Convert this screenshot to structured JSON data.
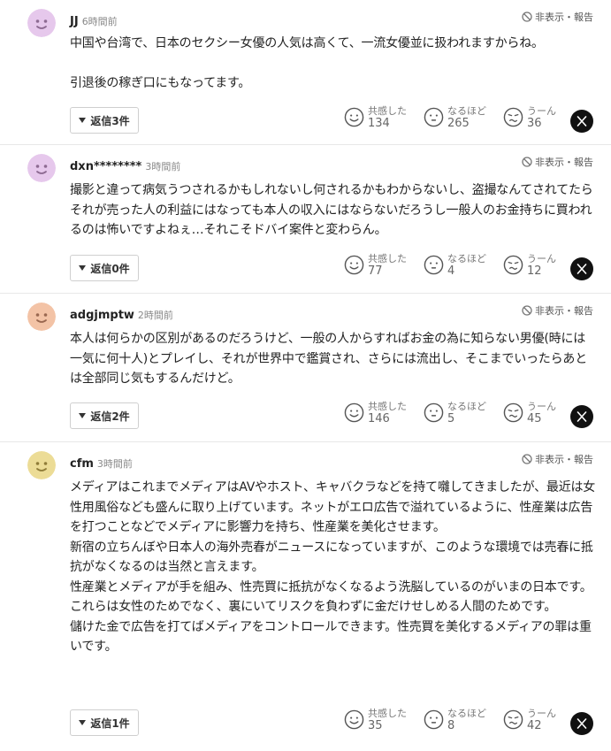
{
  "report_label": "非表示・報告",
  "reactions": {
    "empathy_label": "共感した",
    "naruhodo_label": "なるほど",
    "uun_label": "うーん"
  },
  "comments": [
    {
      "username": "JJ",
      "time": "6時間前",
      "avatar_color": "#e6c8ec",
      "body": "中国や台湾で、日本のセクシー女優の人気は高くて、一流女優並に扱われますからね。\n\n引退後の稼ぎ口にもなってます。",
      "reply_label": "返信3件",
      "empathy": "134",
      "naruhodo": "265",
      "uun": "36"
    },
    {
      "username": "dxn********",
      "time": "3時間前",
      "avatar_color": "#e6c8ec",
      "body": "撮影と違って病気うつされるかもしれないし何されるかもわからないし、盗撮なんてされてたらそれが売った人の利益にはなっても本人の収入にはならないだろうし一般人のお金持ちに買われるのは怖いですよねぇ…それこそドバイ案件と変わらん。",
      "reply_label": "返信0件",
      "empathy": "77",
      "naruhodo": "4",
      "uun": "12"
    },
    {
      "username": "adgjmptw",
      "time": "2時間前",
      "avatar_color": "#f3c3a6",
      "body": "本人は何らかの区別があるのだろうけど、一般の人からすればお金の為に知らない男優(時には一気に何十人)とプレイし、それが世界中で鑑賞され、さらには流出し、そこまでいったらあとは全部同じ気もするんだけど。",
      "reply_label": "返信2件",
      "empathy": "146",
      "naruhodo": "5",
      "uun": "45"
    },
    {
      "username": "cfm",
      "time": "3時間前",
      "avatar_color": "#ecdc96",
      "body": "メディアはこれまでメディアはAVやホスト、キャバクラなどを持て囃してきましたが、最近は女性用風俗なども盛んに取り上げています。ネットがエロ広告で溢れているように、性産業は広告を打つことなどでメディアに影響力を持ち、性産業を美化させます。\n新宿の立ちんぼや日本人の海外売春がニュースになっていますが、このような環境では売春に抵抗がなくなるのは当然と言えます。\n性産業とメディアが手を組み、性売買に抵抗がなくなるよう洗脳しているのがいまの日本です。\nこれらは女性のためでなく、裏にいてリスクを負わずに金だけせしめる人間のためです。\n儲けた金で広告を打てばメディアをコントロールできます。性売買を美化するメディアの罪は重いです。",
      "reply_label": "返信1件",
      "empathy": "35",
      "naruhodo": "8",
      "uun": "42"
    }
  ]
}
